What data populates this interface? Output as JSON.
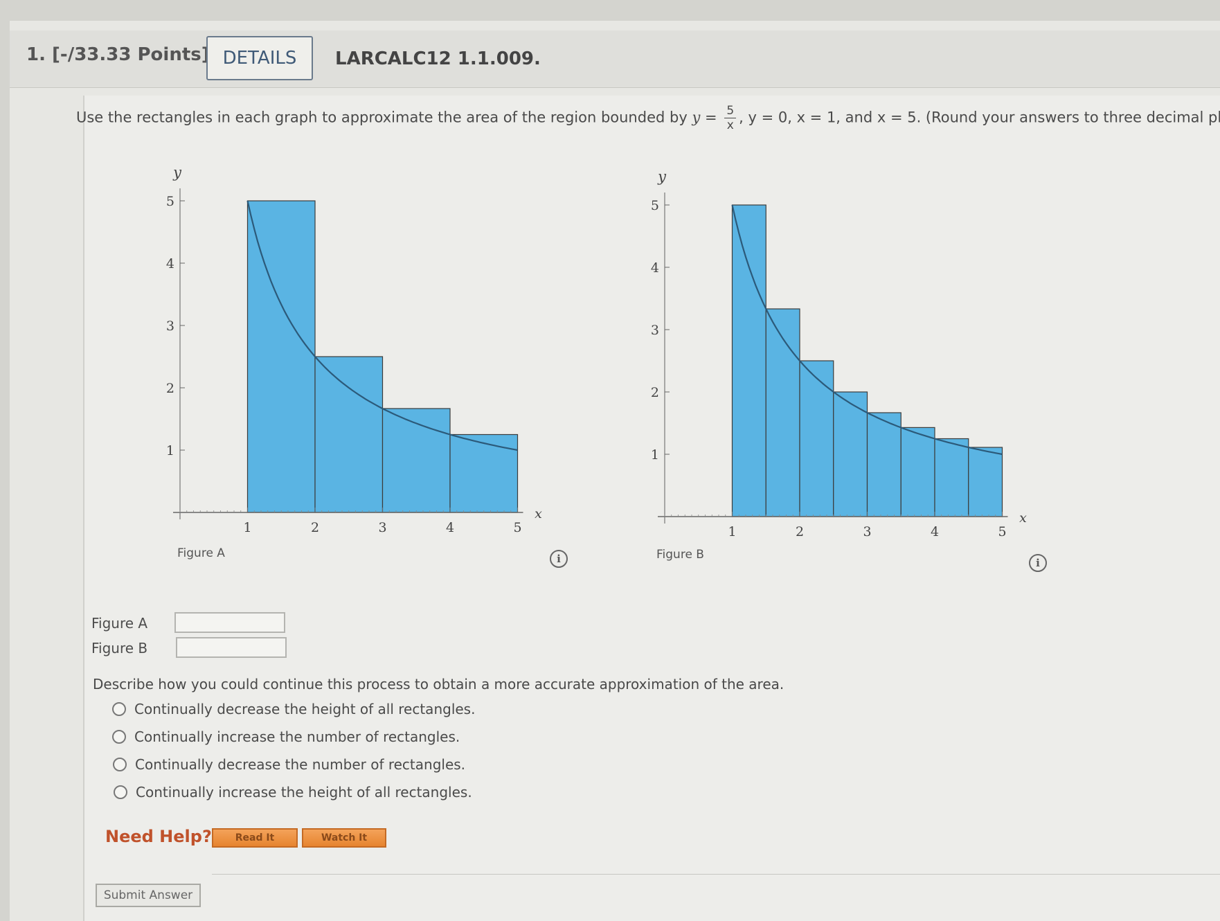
{
  "question": {
    "number": "1.",
    "points": "[-/33.33 Points]",
    "details_label": "DETAILS",
    "code": "LARCALC12 1.1.009."
  },
  "prompt": {
    "before": "Use the rectangles in each graph to approximate the area of the region bounded by",
    "y_var": "y",
    "eq": "=",
    "frac_num": "5",
    "frac_den": "x",
    "after": ", y = 0, x = 1, and x = 5. (Round your answers to three decimal places."
  },
  "figure_a": {
    "caption": "Figure A",
    "chart_data": {
      "type": "bar",
      "function": "y = 5/x",
      "x_edges": [
        1,
        2,
        3,
        4,
        5
      ],
      "values": [
        5,
        2.5,
        1.667,
        1.25
      ],
      "xlim": [
        0,
        5
      ],
      "ylim": [
        0,
        5
      ],
      "xticks": [
        "1",
        "2",
        "3",
        "4",
        "5"
      ],
      "yticks": [
        "1",
        "2",
        "3",
        "4",
        "5"
      ],
      "xlabel": "x",
      "ylabel": "y"
    }
  },
  "figure_b": {
    "caption": "Figure B",
    "chart_data": {
      "type": "bar",
      "function": "y = 5/x",
      "x_edges": [
        1,
        1.5,
        2,
        2.5,
        3,
        3.5,
        4,
        4.5,
        5
      ],
      "values": [
        5,
        3.333,
        2.5,
        2,
        1.667,
        1.429,
        1.25,
        1.111
      ],
      "xlim": [
        0,
        5
      ],
      "ylim": [
        0,
        5
      ],
      "xticks": [
        "1",
        "2",
        "3",
        "4",
        "5"
      ],
      "yticks": [
        "1",
        "2",
        "3",
        "4",
        "5"
      ],
      "xlabel": "x",
      "ylabel": "y"
    }
  },
  "colors": {
    "bar_fill": "#5ab4e3",
    "bar_stroke": "#3b3b3b",
    "curve": "#2c5a7a"
  },
  "answers": {
    "a_label": "Figure A",
    "b_label": "Figure B",
    "a_value": "",
    "b_value": ""
  },
  "describe": {
    "question": "Describe how you could continue this process to obtain a more accurate approximation of the area.",
    "options": [
      "Continually decrease the height of all rectangles.",
      "Continually increase the number of rectangles.",
      "Continually decrease the number of rectangles.",
      "Continually increase the height of all rectangles."
    ]
  },
  "help": {
    "label": "Need Help?",
    "read_it": "Read It",
    "watch_it": "Watch It"
  },
  "submit_label": "Submit Answer"
}
